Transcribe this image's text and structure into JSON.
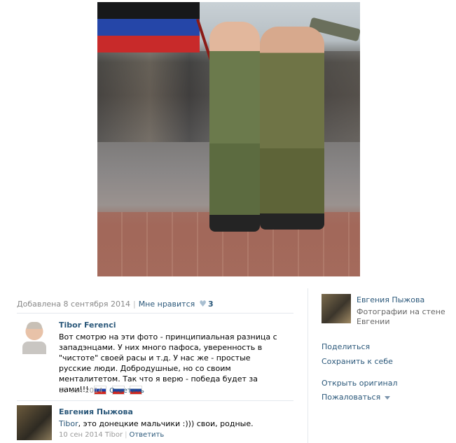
{
  "meta": {
    "added": "Добавлена 8 сентября 2014",
    "like_label": "Мне нравится",
    "like_count": "3"
  },
  "comments": [
    {
      "author": "Tibor Ferenci",
      "text": "Вот смотрю на эти фото - принципиальная разница с западэнцами. У них много пафоса, уверенность в \"чистоте\" своей расы и т.д. У нас же - простые русские люди. Добродушные, но со своим менталитетом. Так что я верю - победа будет за нами!!!",
      "date": "10 сен 2014",
      "reply": "Ответить"
    },
    {
      "author": "Евгения Пыжова",
      "addressee": "Tibor",
      "text": ", это донецкие мальчики :))) свои, родные.",
      "date": "10 сен 2014",
      "to": "Tibor",
      "reply": "Ответить"
    }
  ],
  "sidebar": {
    "owner_name": "Евгения Пыжова",
    "album": "Фотографии на стене Евгении",
    "actions": {
      "share": "Поделиться",
      "save": "Сохранить к себе",
      "open_original": "Открыть оригинал",
      "report": "Пожаловаться"
    }
  },
  "icons": {
    "heart": "heart-icon",
    "flag": "russia-flag-icon",
    "caret": "caret-down-icon"
  },
  "colors": {
    "link": "#2b587a",
    "muted": "#888888",
    "divider": "#e4e8ed"
  }
}
